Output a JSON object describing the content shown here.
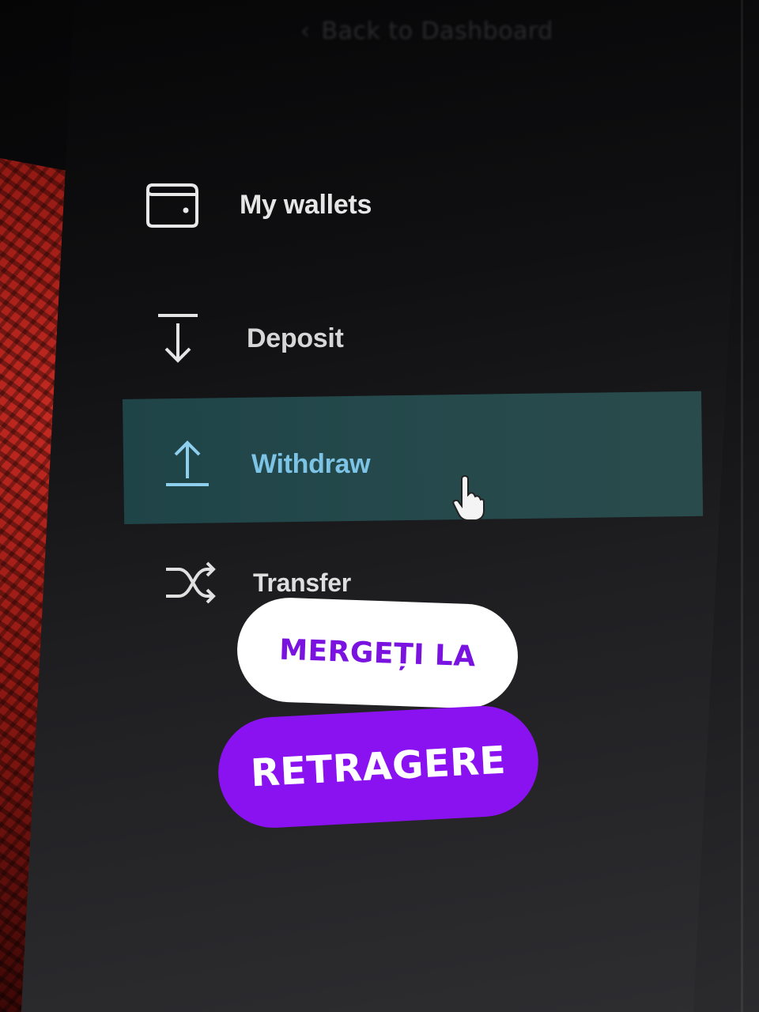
{
  "header": {
    "back_label": "Back to Dashboard",
    "back_icon": "chevron-left-icon"
  },
  "menu": {
    "items": [
      {
        "label": "My wallets",
        "icon": "wallet-icon",
        "active": false
      },
      {
        "label": "Deposit",
        "icon": "arrow-down-icon",
        "active": false
      },
      {
        "label": "Withdraw",
        "icon": "arrow-up-icon",
        "active": true
      },
      {
        "label": "Transfer",
        "icon": "shuffle-icon",
        "active": false
      }
    ]
  },
  "overlay": {
    "line1": "MERGEȚI LA",
    "line2": "RETRAGERE"
  },
  "colors": {
    "active_background": "#264a4c",
    "active_text": "#7cc3e6",
    "overlay_purple": "#8a12f0",
    "overlay_text_purple": "#7a12e0"
  }
}
